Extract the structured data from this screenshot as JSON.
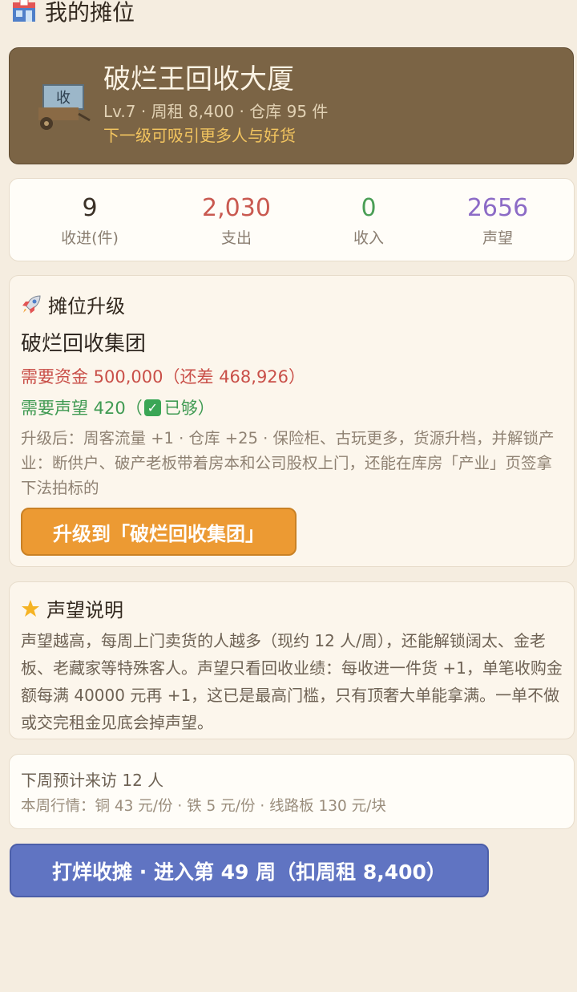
{
  "header": {
    "icon": "shop-icon",
    "title": "我的摊位"
  },
  "stall": {
    "name": "破烂王回收大厦",
    "meta": "Lv.7 · 周租 8,400 · 仓库 95 件",
    "hint": "下一级可吸引更多人与好货",
    "image_sign": "收"
  },
  "stats": [
    {
      "value": "9",
      "label": "收进(件)",
      "color": "#3b3127"
    },
    {
      "value": "2,030",
      "label": "支出",
      "color": "#c95950"
    },
    {
      "value": "0",
      "label": "收入",
      "color": "#4a9e55"
    },
    {
      "value": "2656",
      "label": "声望",
      "color": "#8c6bc6"
    }
  ],
  "upgrade": {
    "title": "摊位升级",
    "icon": "rocket-icon",
    "target": "破烂回收集团",
    "req_money": "需要资金 500,000（还差 468,926）",
    "req_rep_prefix": "需要声望 420（",
    "req_rep_suffix": "已够）",
    "description": "升级后：周客流量 +1 · 仓库 +25 · 保险柜、古玩更多，货源升档，并解锁产业：断供户、破产老板带着房本和公司股权上门，还能在库房「产业」页签拿下法拍标的",
    "button": "升级到「破烂回收集团」"
  },
  "reputation": {
    "title": "声望说明",
    "icon": "star-icon",
    "text": "声望越高，每周上门卖货的人越多（现约 12 人/周），还能解锁阔太、金老板、老藏家等特殊客人。声望只看回收业绩：每收进一件货 +1，单笔收购金额每满 40000 元再 +1，这已是最高门槛，只有顶奢大单能拿满。一单不做或交完租金见底会掉声望。"
  },
  "forecast": {
    "visitors": "下周预计来访 12 人",
    "market": "本周行情：铜 43 元/份 · 铁 5 元/份 · 线路板 130 元/块"
  },
  "end_week": {
    "button": "打烊收摊 · 进入第 49 周（扣周租 8,400）"
  }
}
